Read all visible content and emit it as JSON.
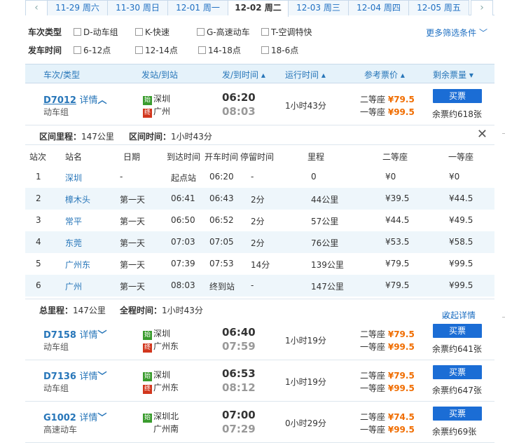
{
  "date_bar": {
    "tabs": [
      "11-29 周六",
      "11-30 周日",
      "12-01 周一",
      "12-02 周二",
      "12-03 周三",
      "12-04 周四",
      "12-05 周五"
    ],
    "active_index": 3
  },
  "filters": {
    "type_label": "车次类型",
    "types": [
      "D-动车组",
      "K-快速",
      "G-高速动车",
      "T-空调特快"
    ],
    "time_label": "发车时间",
    "times": [
      "6-12点",
      "12-14点",
      "14-18点",
      "18-6点"
    ],
    "more": "更多筛选条件"
  },
  "columns": {
    "train": "车次/类型",
    "station": "发站/到站",
    "time": "发/到时间",
    "duration": "运行时间",
    "price": "参考票价",
    "remain": "剩余票量"
  },
  "trains": [
    {
      "no": "D7012",
      "detail": "详情",
      "type": "动车组",
      "from": "深圳",
      "to": "广州",
      "dep": "06:20",
      "arr": "08:03",
      "duration": "1小时43分",
      "seat2": "二等座",
      "price2": "¥79.5",
      "seat1": "一等座",
      "price1": "¥99.5",
      "buy": "买票",
      "remain": "余票约618张",
      "expanded": true
    },
    {
      "no": "D7158",
      "detail": "详情",
      "type": "动车组",
      "from": "深圳",
      "to": "广州东",
      "dep": "06:40",
      "arr": "07:59",
      "duration": "1小时19分",
      "seat2": "二等座",
      "price2": "¥79.5",
      "seat1": "一等座",
      "price1": "¥99.5",
      "buy": "买票",
      "remain": "余票约641张"
    },
    {
      "no": "D7136",
      "detail": "详情",
      "type": "动车组",
      "from": "深圳",
      "to": "广州东",
      "dep": "06:53",
      "arr": "08:12",
      "duration": "1小时19分",
      "seat2": "二等座",
      "price2": "¥79.5",
      "seat1": "一等座",
      "price1": "¥99.5",
      "buy": "买票",
      "remain": "余票约647张"
    },
    {
      "no": "G1002",
      "detail": "详情",
      "type": "高速动车",
      "from": "深圳北",
      "to": "广州南",
      "dep": "07:00",
      "arr": "07:29",
      "duration": "0小时29分",
      "seat2": "二等座",
      "price2": "¥74.5",
      "seat1": "一等座",
      "price1": "¥99.5",
      "buy": "买票",
      "remain": "余票约69张"
    }
  ],
  "detail": {
    "segment_distance_label": "区间里程：",
    "segment_distance": "147公里",
    "segment_time_label": "区间时间：",
    "segment_time": "1小时43分",
    "headers": [
      "站次",
      "站名",
      "日期",
      "到达时间",
      "开车时间",
      "停留时间",
      "里程",
      "二等座",
      "一等座"
    ],
    "stops": [
      [
        "1",
        "深圳",
        "-",
        "起点站",
        "06:20",
        "-",
        "0",
        "¥0",
        "¥0"
      ],
      [
        "2",
        "樟木头",
        "第一天",
        "06:41",
        "06:43",
        "2分",
        "44公里",
        "¥39.5",
        "¥44.5"
      ],
      [
        "3",
        "常平",
        "第一天",
        "06:50",
        "06:52",
        "2分",
        "57公里",
        "¥44.5",
        "¥49.5"
      ],
      [
        "4",
        "东莞",
        "第一天",
        "07:03",
        "07:05",
        "2分",
        "76公里",
        "¥53.5",
        "¥58.5"
      ],
      [
        "5",
        "广州东",
        "第一天",
        "07:39",
        "07:53",
        "14分",
        "139公里",
        "¥79.5",
        "¥99.5"
      ],
      [
        "6",
        "广州",
        "第一天",
        "08:03",
        "终到站",
        "-",
        "147公里",
        "¥79.5",
        "¥99.5"
      ]
    ],
    "total_distance_label": "总里程：",
    "total_distance": "147公里",
    "total_time_label": "全程时间：",
    "total_time": "1小时43分",
    "collapse": "收起详情"
  },
  "badges": {
    "start": "始",
    "end": "终"
  }
}
